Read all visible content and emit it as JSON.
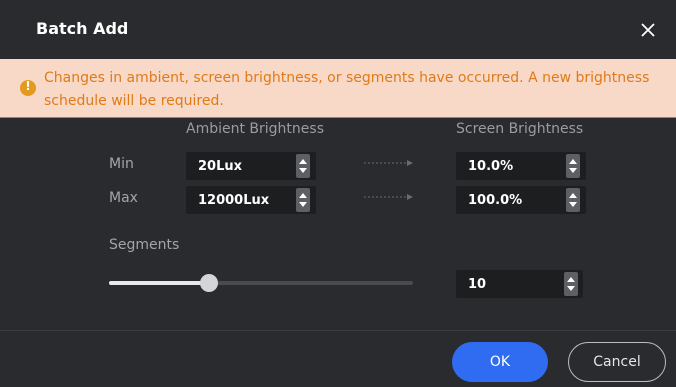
{
  "dialog": {
    "title": "Batch Add",
    "close_icon": "close-icon"
  },
  "warning": {
    "icon": "warning-icon",
    "text": "Changes in ambient, screen brightness, or segments have occurred. A new brightness schedule will be required."
  },
  "columns": {
    "ambient": "Ambient Brightness",
    "screen": "Screen Brightness"
  },
  "rows": {
    "min_label": "Min",
    "max_label": "Max"
  },
  "fields": {
    "ambient_min": "20Lux",
    "ambient_max": "12000Lux",
    "screen_min": "10.0%",
    "screen_max": "100.0%"
  },
  "segments": {
    "label": "Segments",
    "value": "10",
    "slider_fraction": 0.33
  },
  "buttons": {
    "ok": "OK",
    "cancel": "Cancel"
  },
  "colors": {
    "accent": "#2f6cf2",
    "warning_bg": "#f8d9c7",
    "warning_text": "#e07a18",
    "warning_icon": "#e39b1d",
    "dialog_bg": "#2a2b2e"
  }
}
